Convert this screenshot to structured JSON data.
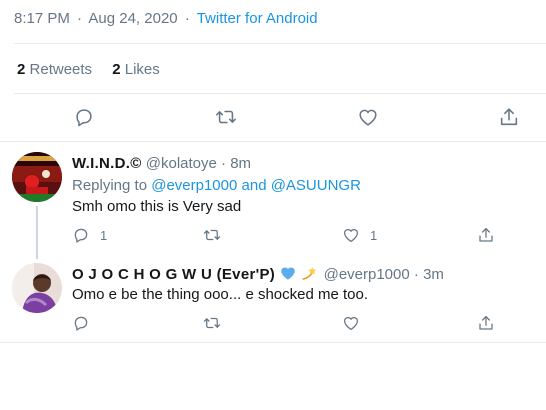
{
  "tweet_meta": {
    "time": "8:17 PM",
    "date": "Aug 24, 2020",
    "separator": "·",
    "client": "Twitter for Android"
  },
  "stats": {
    "retweets_count": "2",
    "retweets_label": "Retweets",
    "likes_count": "2",
    "likes_label": "Likes"
  },
  "main_actions": {
    "icons": [
      "reply-icon",
      "retweet-icon",
      "like-icon",
      "share-icon"
    ]
  },
  "replies": [
    {
      "name": "W.I.N.D.©",
      "handle": "@kolatoye",
      "dot": "·",
      "time": "8m",
      "replying_prefix": "Replying to",
      "replying_mentions": "@everp1000 and @ASUUNGR",
      "text": "Smh omo this is Very sad",
      "reply_count": "1",
      "retweet_count": "",
      "like_count": "1"
    },
    {
      "name": "O J O C H O G W U (Ever'P)",
      "handle": "@everp1000",
      "dot": "·",
      "time": "3m",
      "text": "Omo e be the thing ooo... e shocked me too.",
      "reply_count": "",
      "retweet_count": "",
      "like_count": ""
    }
  ],
  "colors": {
    "link": "#1b95e0",
    "secondary": "#657786",
    "primary_text": "#14171a",
    "divider": "#e6ecf0",
    "heart_emoji": "#5dadec",
    "dizzy_emoji": "#ffcc4d"
  }
}
